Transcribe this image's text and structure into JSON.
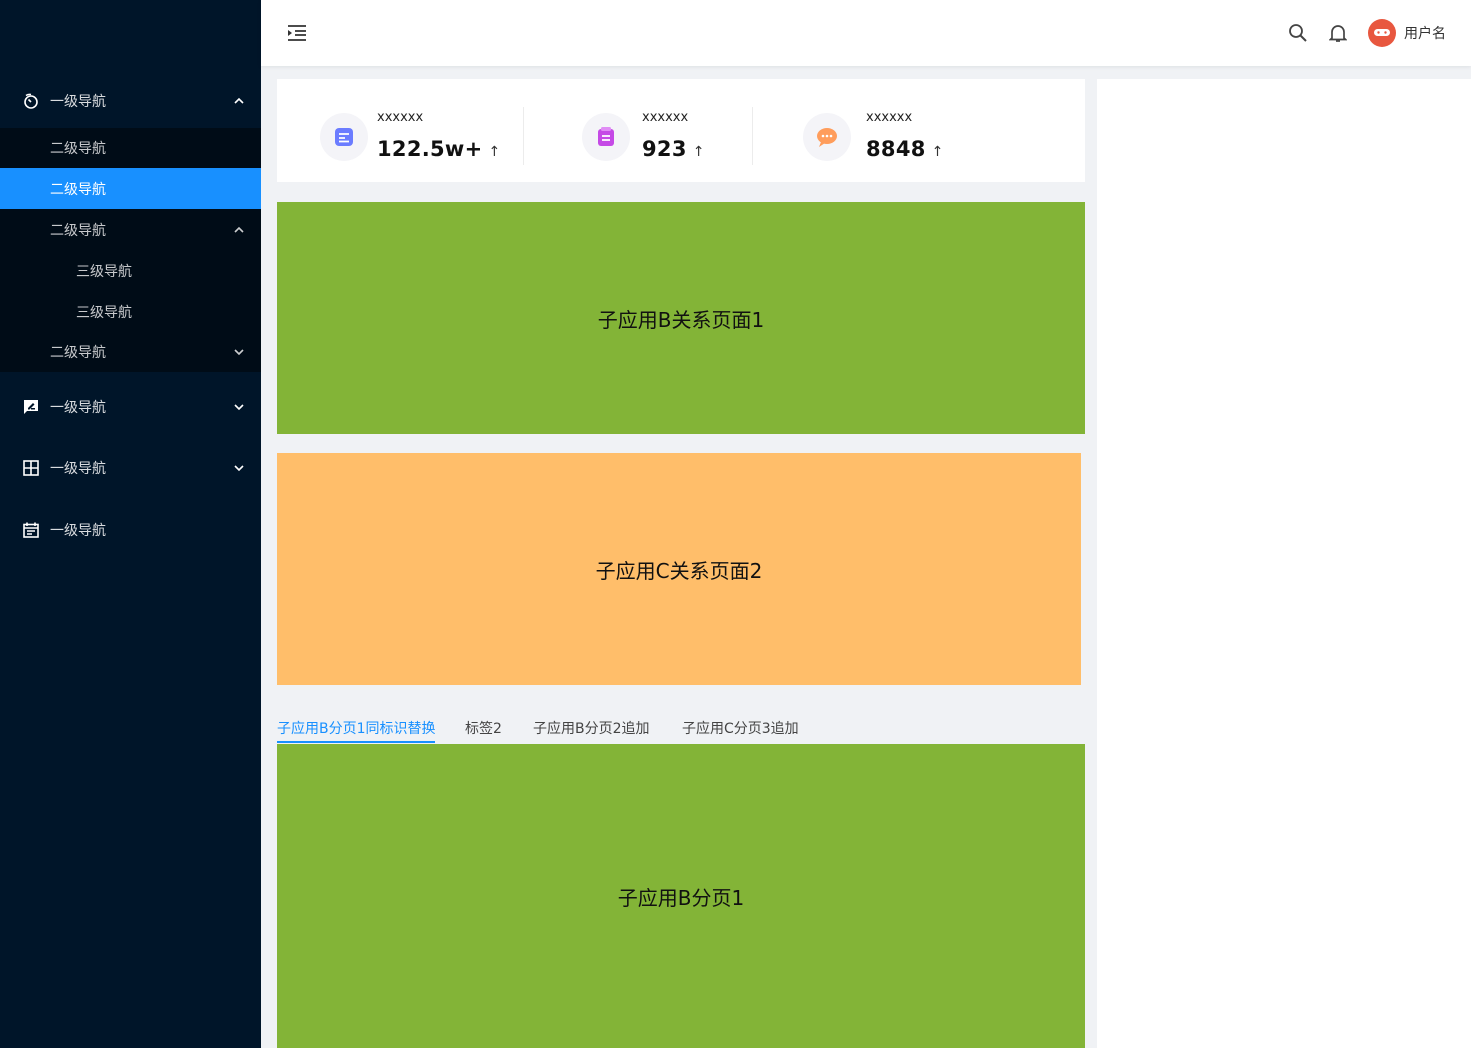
{
  "sidebar": {
    "menu1": {
      "label": "一级导航",
      "icon": "timer-icon",
      "expanded": true
    },
    "sub1": {
      "label": "二级导航"
    },
    "sub2": {
      "label": "二级导航",
      "active": true
    },
    "sub3": {
      "label": "二级导航",
      "expanded": true
    },
    "sub3_items": [
      {
        "label": "三级导航"
      },
      {
        "label": "三级导航"
      }
    ],
    "sub4": {
      "label": "二级导航"
    },
    "menu2": {
      "label": "一级导航",
      "icon": "feedback-icon"
    },
    "menu3": {
      "label": "一级导航",
      "icon": "grid-icon"
    },
    "menu4": {
      "label": "一级导航",
      "icon": "calendar-icon"
    }
  },
  "header": {
    "username": "用户名"
  },
  "stats": [
    {
      "label": "xxxxxx",
      "value": "122.5w+",
      "trend": "↑",
      "icon": "document-icon",
      "color": "#6b7cff"
    },
    {
      "label": "xxxxxx",
      "value": "923",
      "trend": "↑",
      "icon": "list-icon",
      "color": "#c549e6"
    },
    {
      "label": "xxxxxx",
      "value": "8848",
      "trend": "↑",
      "icon": "chat-icon",
      "color": "#ff9d5c"
    }
  ],
  "panels": {
    "page1": "子应用B关系页面1",
    "page2": "子应用C关系页面2",
    "tab_content": "子应用B分页1"
  },
  "tabs": [
    {
      "label": "子应用B分页1同标识替换",
      "active": true
    },
    {
      "label": "标签2"
    },
    {
      "label": "子应用B分页2追加"
    },
    {
      "label": "子应用C分页3追加"
    }
  ],
  "colors": {
    "sidebar_bg": "#001529",
    "submenu_bg": "#000c17",
    "accent": "#1890ff",
    "green_panel": "#83b437",
    "orange_panel": "#ffbe6a"
  }
}
